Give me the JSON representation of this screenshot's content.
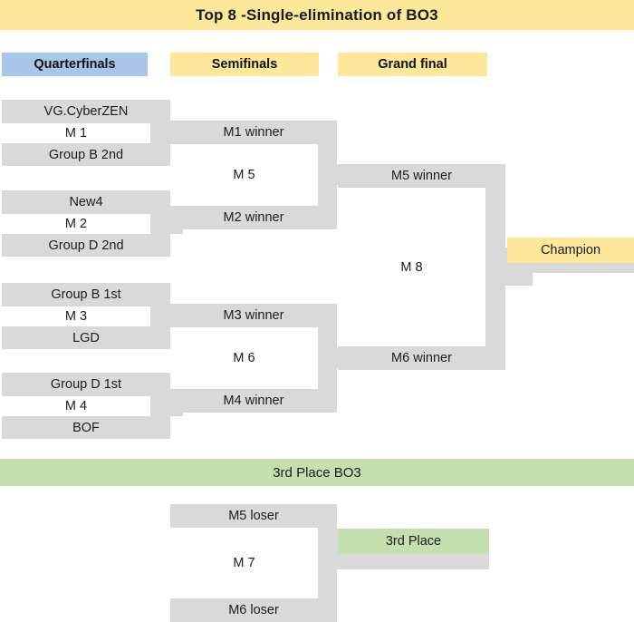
{
  "title": "Top 8 -Single-elimination of BO3",
  "stages": [
    {
      "label": "Quarterfinals",
      "color": "#a8c6e8"
    },
    {
      "label": "Semifinals",
      "color": "#fce79a"
    },
    {
      "label": "Grand final",
      "color": "#fce79a"
    }
  ],
  "quarterfinals": [
    {
      "match": "M 1",
      "top": "VG.CyberZEN",
      "bottom": "Group B 2nd"
    },
    {
      "match": "M 2",
      "top": "New4",
      "bottom": "Group D 2nd"
    },
    {
      "match": "M 3",
      "top": "Group B 1st",
      "bottom": "LGD"
    },
    {
      "match": "M 4",
      "top": "Group D 1st",
      "bottom": "BOF"
    }
  ],
  "semifinals": [
    {
      "match": "M 5",
      "top": "M1 winner",
      "bottom": "M2 winner"
    },
    {
      "match": "M 6",
      "top": "M3 winner",
      "bottom": "M4 winner"
    }
  ],
  "grand_final": {
    "match": "M 8",
    "top": "M5 winner",
    "bottom": "M6 winner"
  },
  "champion": {
    "label": "Champion",
    "color": "#fce79a"
  },
  "third_place_section": {
    "banner": "3rd Place BO3",
    "banner_color": "#c5dfae",
    "match": {
      "match": "M 7",
      "top": "M5 loser",
      "bottom": "M6 loser"
    },
    "result": {
      "label": "3rd Place",
      "color": "#c5dfae"
    }
  },
  "colors": {
    "bracket_gray": "#d9d9d9",
    "title_yellow": "#fce79a",
    "quarterfinal_blue": "#a8c6e8",
    "third_green": "#c5dfae",
    "background": "#ffffff"
  }
}
